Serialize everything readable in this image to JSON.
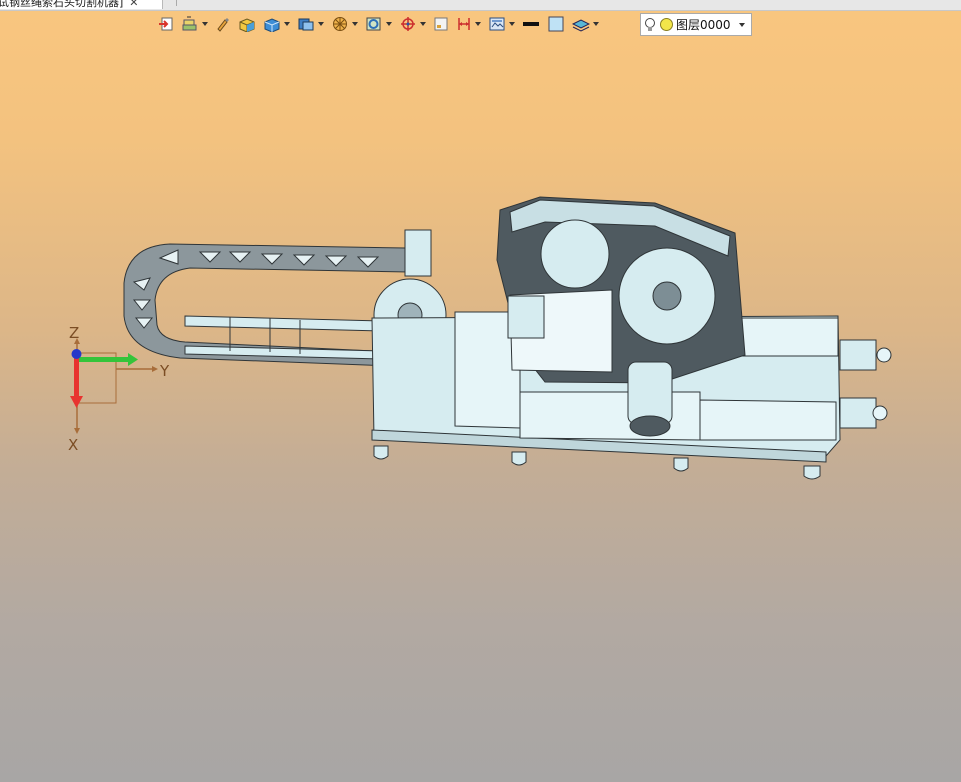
{
  "document": {
    "tab_title": "试钢丝绳索石头切割机器]",
    "close_glyph": "✕"
  },
  "toolbar": {
    "tools": [
      {
        "name": "import-icon",
        "has_menu": false
      },
      {
        "name": "layer-stack-icon",
        "has_menu": true
      },
      {
        "name": "brush-icon",
        "has_menu": false
      },
      {
        "name": "shaded-box-icon",
        "has_menu": false
      },
      {
        "name": "solid-box-icon",
        "has_menu": true
      },
      {
        "name": "view-cube-icon",
        "has_menu": true
      },
      {
        "name": "section-wheel-icon",
        "has_menu": true
      },
      {
        "name": "display-mode-icon",
        "has_menu": true
      },
      {
        "name": "snap-target-icon",
        "has_menu": true
      },
      {
        "name": "measure-icon",
        "has_menu": false
      },
      {
        "name": "dimension-icon",
        "has_menu": true
      },
      {
        "name": "render-icon",
        "has_menu": true
      },
      {
        "name": "line-color-icon",
        "has_menu": false
      },
      {
        "name": "fill-color-icon",
        "has_menu": false
      },
      {
        "name": "layers-icon",
        "has_menu": true
      }
    ],
    "layer_select": {
      "value": "图层0000"
    }
  },
  "triad": {
    "z_label": "Z",
    "y_label": "Y",
    "x_label": "X"
  },
  "colors": {
    "model_fill": "#d6ecf0",
    "model_dark": "#4f5a60",
    "model_edge": "#2f3538",
    "axis_x": "#e8332f",
    "axis_y": "#35c43a",
    "axis_z": "#2738c9"
  }
}
